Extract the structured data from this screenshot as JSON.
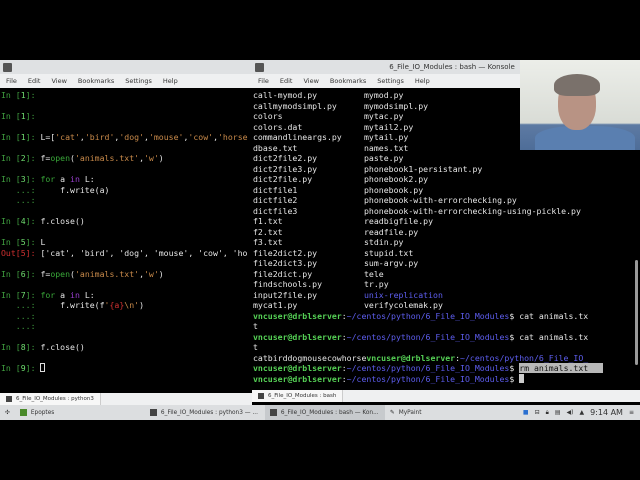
{
  "left_window": {
    "menu": [
      "File",
      "Edit",
      "View",
      "Bookmarks",
      "Settings",
      "Help"
    ],
    "lines": [
      [
        [
          "g",
          "In ["
        ],
        [
          "gb",
          "1"
        ],
        [
          "g",
          "]: "
        ]
      ],
      [],
      [
        [
          "g",
          "In ["
        ],
        [
          "gb",
          "1"
        ],
        [
          "g",
          "]: "
        ]
      ],
      [],
      [
        [
          "g",
          "In ["
        ],
        [
          "gb",
          "1"
        ],
        [
          "g",
          "]: "
        ],
        [
          "",
          "L=["
        ],
        [
          "s",
          "'cat'"
        ],
        [
          "",
          ","
        ],
        [
          "s",
          "'bird'"
        ],
        [
          "",
          ","
        ],
        [
          "s",
          "'dog'"
        ],
        [
          "",
          ","
        ],
        [
          "s",
          "'mouse'"
        ],
        [
          "",
          ","
        ],
        [
          "s",
          "'cow'"
        ],
        [
          "",
          ","
        ],
        [
          "s",
          "'horse"
        ]
      ],
      [],
      [
        [
          "g",
          "In ["
        ],
        [
          "gb",
          "2"
        ],
        [
          "g",
          "]: "
        ],
        [
          "",
          "f="
        ],
        [
          "k",
          "open"
        ],
        [
          "",
          "("
        ],
        [
          "s",
          "'animals.txt'"
        ],
        [
          "",
          ","
        ],
        [
          "s",
          "'w'"
        ],
        [
          "",
          ")"
        ]
      ],
      [],
      [
        [
          "g",
          "In ["
        ],
        [
          "gb",
          "3"
        ],
        [
          "g",
          "]: "
        ],
        [
          "k",
          "for"
        ],
        [
          "",
          " a "
        ],
        [
          "p",
          "in"
        ],
        [
          "",
          " L:"
        ]
      ],
      [
        [
          "g",
          "   ...: "
        ],
        [
          "",
          "    f.write(a)"
        ]
      ],
      [
        [
          "g",
          "   ...: "
        ]
      ],
      [],
      [
        [
          "g",
          "In ["
        ],
        [
          "gb",
          "4"
        ],
        [
          "g",
          "]: "
        ],
        [
          "",
          "f.close()"
        ]
      ],
      [],
      [
        [
          "g",
          "In ["
        ],
        [
          "gb",
          "5"
        ],
        [
          "g",
          "]: "
        ],
        [
          "",
          "L"
        ]
      ],
      [
        [
          "r",
          "Out[5]: "
        ],
        [
          "",
          "['cat', 'bird', 'dog', 'mouse', 'cow', 'ho"
        ]
      ],
      [],
      [
        [
          "g",
          "In ["
        ],
        [
          "gb",
          "6"
        ],
        [
          "g",
          "]: "
        ],
        [
          "",
          "f="
        ],
        [
          "k",
          "open"
        ],
        [
          "",
          "("
        ],
        [
          "s",
          "'animals.txt'"
        ],
        [
          "",
          ","
        ],
        [
          "s",
          "'w'"
        ],
        [
          "",
          ")"
        ]
      ],
      [],
      [
        [
          "g",
          "In ["
        ],
        [
          "gb",
          "7"
        ],
        [
          "g",
          "]: "
        ],
        [
          "k",
          "for"
        ],
        [
          "",
          " a "
        ],
        [
          "p",
          "in"
        ],
        [
          "",
          " L:"
        ]
      ],
      [
        [
          "g",
          "   ...: "
        ],
        [
          "",
          "    f.write(f"
        ],
        [
          "s",
          "'"
        ],
        [
          "r",
          "{a}"
        ],
        [
          "s",
          "\\n'"
        ],
        [
          "",
          ")"
        ]
      ],
      [
        [
          "g",
          "   ...: "
        ]
      ],
      [
        [
          "g",
          "   ...: "
        ]
      ],
      [],
      [
        [
          "g",
          "In ["
        ],
        [
          "gb",
          "8"
        ],
        [
          "g",
          "]: "
        ],
        [
          "",
          "f.close()"
        ]
      ],
      [],
      [
        [
          "g",
          "In ["
        ],
        [
          "gb",
          "9"
        ],
        [
          "g",
          "]: "
        ],
        [
          "cursor",
          ""
        ]
      ]
    ],
    "tab": "6_File_IO_Modules : python3"
  },
  "right_window": {
    "title": "6_File_IO_Modules : bash — Konsole",
    "menu": [
      "File",
      "Edit",
      "View",
      "Bookmarks",
      "Settings",
      "Help"
    ],
    "files_col1": [
      "call-mymod.py",
      "callmymodsimpl.py",
      "colors",
      "colors.dat",
      "commandlineargs.py",
      "dbase.txt",
      "dict2file2.py",
      "dict2file3.py",
      "dict2file.py",
      "dictfile1",
      "dictfile2",
      "dictfile3",
      "f1.txt",
      "f2.txt",
      "f3.txt",
      "file2dict2.py",
      "file2dict3.py",
      "file2dict.py",
      "findschools.py",
      "input2file.py",
      "mycat1.py"
    ],
    "files_col2": [
      "mymod.py",
      "mymodsimpl.py",
      "mytac.py",
      "mytail2.py",
      "mytail.py",
      "names.txt",
      "paste.py",
      "phonebook1-persistant.py",
      "phonebook2.py",
      "phonebook.py",
      "phonebook-with-errorchecking.py",
      "phonebook-with-errorchecking-using-pickle.py",
      "readbigfile.py",
      "readfile.py",
      "stdin.py",
      "stupid.txt",
      "sum-argv.py",
      "tele",
      "tr.py",
      "unix-replication",
      "verifycolemak.py"
    ],
    "dir_entry": "unix-replication",
    "lines": [
      [
        [
          "u",
          "vncuser@drblserver"
        ],
        [
          "",
          ":"
        ],
        [
          "b",
          "~/centos/python/6_File_IO_Modules"
        ],
        [
          "",
          "$ cat animals.tx"
        ]
      ],
      [
        [
          "",
          "t"
        ]
      ],
      [
        [
          "u",
          "vncuser@drblserver"
        ],
        [
          "",
          ":"
        ],
        [
          "b",
          "~/centos/python/6_File_IO_Modules"
        ],
        [
          "",
          "$ cat animals.tx"
        ]
      ],
      [
        [
          "",
          "t"
        ]
      ],
      [
        [
          "",
          "catbirddogmousecowhorse"
        ],
        [
          "u",
          "vncuser@drblserver"
        ],
        [
          "",
          ":"
        ],
        [
          "b",
          "~/centos/python/6_File_IO_"
        ]
      ],
      [
        [
          "u",
          "vncuser@drblserver"
        ],
        [
          "",
          ":"
        ],
        [
          "b",
          "~/centos/python/6_File_IO_Modules"
        ],
        [
          "",
          "$ "
        ],
        [
          "sel",
          "rm animals.txt   "
        ]
      ],
      [
        [
          "u",
          "vncuser@drblserver"
        ],
        [
          "",
          ":"
        ],
        [
          "b",
          "~/centos/python/6_File_IO_Modules"
        ],
        [
          "",
          "$ "
        ],
        [
          "cursorb",
          ""
        ]
      ]
    ],
    "tab": "6_File_IO_Modules : bash"
  },
  "taskbar": {
    "items": [
      "Epoptes",
      "6_File_IO_Modules : python3 — ...",
      "6_File_IO_Modules : bash — Kon...",
      "MyPaint"
    ],
    "clock": "9:14 AM"
  }
}
